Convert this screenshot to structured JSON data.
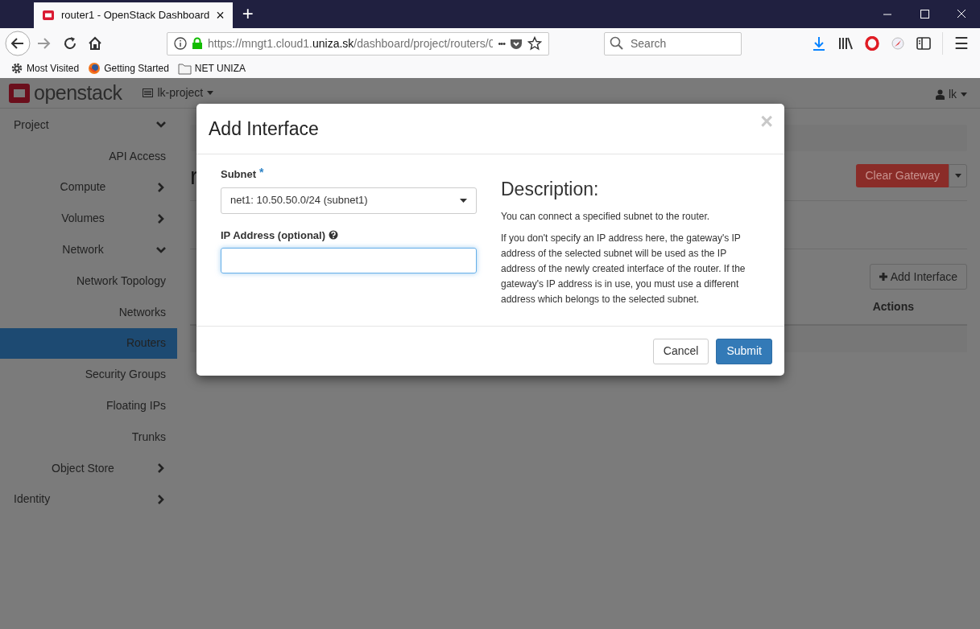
{
  "browser": {
    "tab": {
      "title": "router1 - OpenStack Dashboard",
      "close": "×"
    },
    "new_tab": "+",
    "url": {
      "scheme_host": "https://mngt1.cloud1.",
      "domain": "uniza.sk",
      "path": "/dashboard/project/routers/0"
    },
    "more": "•••",
    "search": {
      "placeholder": "Search"
    },
    "menu": "☰",
    "bookmarks": [
      {
        "kind": "gear",
        "label": "Most Visited"
      },
      {
        "kind": "firefox",
        "label": "Getting Started"
      },
      {
        "kind": "folder",
        "label": "NET UNIZA"
      }
    ]
  },
  "header": {
    "logo": "openstack",
    "project": "lk-project",
    "user": "lk"
  },
  "sidebar": {
    "items": [
      {
        "label": "Project",
        "expanded": true,
        "children": [
          {
            "label": "API Access",
            "selected": false
          },
          {
            "label": "Compute",
            "expanded": false
          },
          {
            "label": "Volumes",
            "expanded": false
          },
          {
            "label": "Network",
            "expanded": true,
            "children": [
              {
                "label": "Network Topology",
                "selected": false
              },
              {
                "label": "Networks",
                "selected": false
              },
              {
                "label": "Routers",
                "selected": true
              },
              {
                "label": "Security Groups",
                "selected": false
              },
              {
                "label": "Floating IPs",
                "selected": false
              },
              {
                "label": "Trunks",
                "selected": false
              }
            ]
          },
          {
            "label": "Object Store",
            "expanded": false
          }
        ]
      },
      {
        "label": "Identity",
        "expanded": false
      }
    ]
  },
  "page": {
    "title": "r",
    "clear_gateway": "Clear Gateway",
    "add_interface": "Add Interface",
    "table": {
      "columns": [
        "Actions"
      ]
    }
  },
  "modal": {
    "title": "Add Interface",
    "close": "×",
    "fields": [
      {
        "kind": "select",
        "label": "Subnet",
        "required_mark": "*",
        "value": "net1: 10.50.50.0/24 (subnet1)",
        "focused": false
      },
      {
        "kind": "text",
        "label": "IP Address (optional)",
        "help": true,
        "focused": true
      }
    ],
    "description": {
      "heading": "Description:",
      "paragraphs": [
        "You can connect a specified subnet to the router.",
        "If you don't specify an IP address here, the gateway's IP address of the selected subnet will be used as the IP address of the newly created interface of the router. If the gateway's IP address is in use, you must use a different address which belongs to the selected subnet."
      ]
    },
    "buttons": [
      {
        "kind": "secondary",
        "label": "Cancel"
      },
      {
        "kind": "primary",
        "label": "Submit"
      }
    ]
  }
}
